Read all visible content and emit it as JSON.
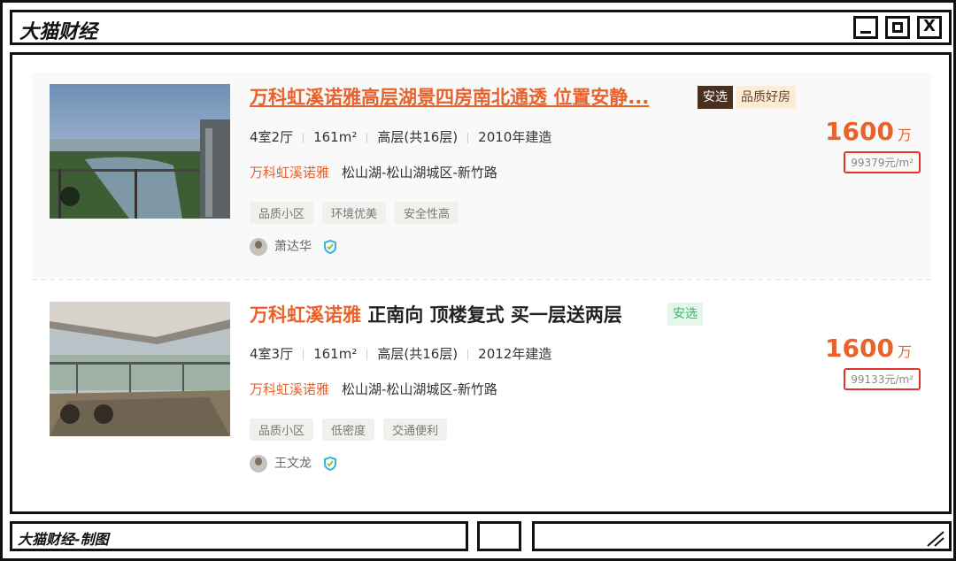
{
  "window": {
    "title": "大猫财经",
    "footer_text": "大猫财经-制图",
    "close_label": "X"
  },
  "listings": [
    {
      "title_main": "万科虹溪诺雅高层湖景四房南北通透 位置安静...",
      "badges": [
        "安选",
        "品质好房"
      ],
      "layout": "4室2厅",
      "area": "161m²",
      "floor": "高层(共16层)",
      "year": "2010年建造",
      "community": "万科虹溪诺雅",
      "location": "松山湖-松山湖城区-新竹路",
      "tags": [
        "品质小区",
        "环境优美",
        "安全性高"
      ],
      "agent": "萧达华",
      "price": "1600",
      "price_unit": "万",
      "unit_price": "99379元/m²"
    },
    {
      "title_community": "万科虹溪诺雅",
      "title_desc": "正南向 顶楼复式 买一层送两层",
      "badges": [
        "安选"
      ],
      "layout": "4室3厅",
      "area": "161m²",
      "floor": "高层(共16层)",
      "year": "2012年建造",
      "community": "万科虹溪诺雅",
      "location": "松山湖-松山湖城区-新竹路",
      "tags": [
        "品质小区",
        "低密度",
        "交通便利"
      ],
      "agent": "王文龙",
      "price": "1600",
      "price_unit": "万",
      "unit_price": "99133元/m²"
    }
  ],
  "colors": {
    "accent": "#e8622c",
    "highlight_box": "#e3322b",
    "badge_dark": "#4a2e1e",
    "badge_green": "#3cb36b"
  }
}
